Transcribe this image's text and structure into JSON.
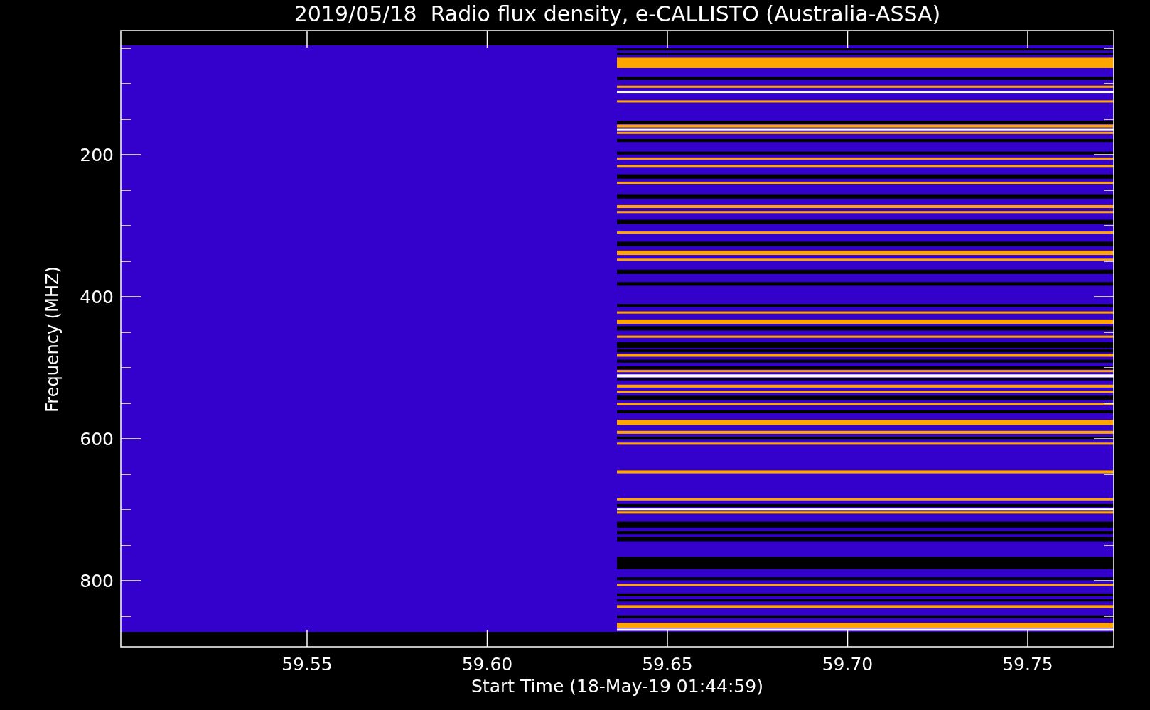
{
  "plot": {
    "title": "2019/05/18  Radio flux density, e-CALLISTO (Australia-ASSA)",
    "ylabel": "Frequency (MHZ)",
    "xlabel": "Start Time (18-May-19 01:44:59)",
    "yticks": [
      "200",
      "400",
      "600",
      "800"
    ],
    "xticks": [
      "59.55",
      "59.60",
      "59.65",
      "59.70",
      "59.75"
    ]
  }
}
